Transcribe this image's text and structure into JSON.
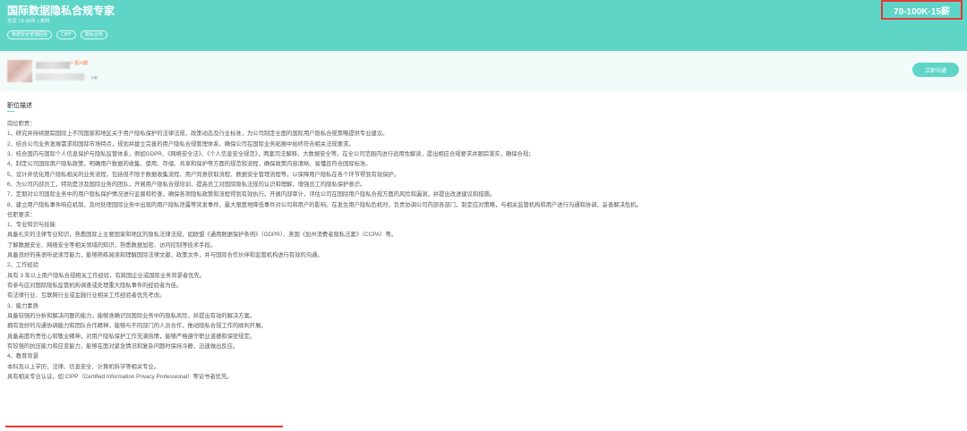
{
  "header": {
    "title": "国际数据隐私合规专家",
    "meta": "北京 | 5-10年 | 本科",
    "tags": [
      "数据安全管理经验",
      "CIPP",
      "隐私合规"
    ],
    "salary": "70-100K·15薪"
  },
  "recruiter": {
    "status": "极兴趣",
    "role": "HR",
    "chat_button": "立即沟通"
  },
  "section": {
    "title": "职位描述"
  },
  "description_lines": [
    "岗位职责：",
    "1、研究并持续跟踪国际上不同国家和地区关于用户隐私保护的法律法规、政策动态及行业标准，为公司制定全面的国际用户隐私合规策略提供专业建议。",
    "2、结合公司业务发展需求和国际市场特点，规划并建立完善的用户隐私合规管理体系，确保公司在国际业务拓展中始终符合相关法规要求。",
    "3、结合国内与国际个人信息保护与隐私监管体系，例如GDPR、《网络安全法》、《个人信息安全规范》，两案司法解释、大数据安全等，在全公司范围内进行适用性解读，提出相应合规要求并跟踪落实，确保合规；",
    "4、制定公司国际用户隐私政策，明确用户数据的收集、使用、存储、共享和保护等方面的规范和流程，确保政策内容清晰、易懂且符合国际标准。",
    "5、设计并优化用户隐私相关的业务流程，包括但不限于数据收集流程、用户同意获取流程、数据安全管理流程等，以保障用户隐私在各个环节得到有效保护。",
    "6、为公司内部员工，特别是涉及国际业务的团队，开展用户隐私合规培训，提高员工对国际隐私法规的认识和理解，增强员工的隐私保护意识。",
    "7、定期对公司国际业务中的用户隐私保护情况进行监督和检查，确保各项隐私政策和流程得到有效执行。开展内部审计，评估公司在国际用户隐私合规方面的风险和漏洞，并提出改进建议和措施。",
    "8、建立用户隐私事件响应机制，及时处理国际业务中出现的用户隐私泄露等突发事件，最大限度地降低事件对公司和用户的影响。在发生用户隐私危机时，负责协调公司内部各部门，制定应对策略，与相关监管机构和用户进行沟通和协调，妥善解决危机。",
    "任职要求：",
    "1、专业知识与技能",
    "具备扎实的法律专业知识，熟悉国际上主要国家和地区的隐私法律法规，如欧盟《通用数据保护条例》（GDPR）、美国《加州消费者隐私法案》（CCPA）等。",
    "了解数据安全、网络安全等相关领域的知识，熟悉数据加密、访问控制等技术手段。",
    "具备良好的英语听说读写能力，能够熟练阅读和理解国际法律文献、政策文件，并与国际合作伙伴和监管机构进行有效的沟通。",
    "2、工作经验",
    "具有 3 年以上用户隐私合规相关工作经验，有跨国企业或国际业务背景者优先。",
    "有参与应对国际隐私监管机构调查或处理重大隐私事件的经验者为佳。",
    "有法律行业、互联网行业或金融行业相关工作经验者优先考虑。",
    "3、能力素质",
    "具备较强的分析和解决问题的能力，能够准确识别国际业务中的隐私风险，并提出有效的解决方案。",
    "拥有良好的沟通协调能力和团队合作精神，能够与不同部门的人员合作，推动隐私合规工作的顺利开展。",
    "具备高度的责任心和敬业精神，对用户隐私保护工作充满热情，能够严格遵守职业道德和保密规定。",
    "有较强的抗压能力和应变能力，能够在面对紧急情况和复杂问题时保持冷静，迅速做出反应。",
    "4、教育背景",
    "本科及以上学历，法律、信息安全、计算机科学等相关专业。",
    "具有相关专业认证，如 CIPP（Certified Information Privacy Professional）等证书者优先。"
  ],
  "colors": {
    "accent": "#5fd5c8",
    "highlight": "#e53935",
    "status": "#ff7a3d"
  }
}
